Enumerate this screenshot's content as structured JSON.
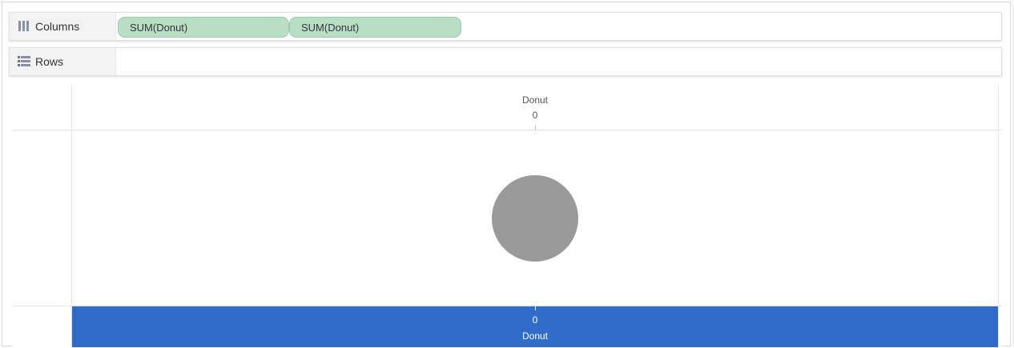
{
  "shelves": {
    "columns": {
      "label": "Columns",
      "icon": "columns-icon",
      "pills": [
        "SUM(Donut)",
        "SUM(Donut)"
      ]
    },
    "rows": {
      "label": "Rows",
      "icon": "rows-icon"
    }
  },
  "chart_data": {
    "type": "pie",
    "top_axis": {
      "title": "Donut",
      "tick_labels": [
        "0"
      ]
    },
    "bottom_axis": {
      "title": "Donut",
      "tick_labels": [
        "0"
      ]
    },
    "marks": [
      {
        "shape": "circle",
        "color": "#9a9a9a"
      }
    ]
  },
  "colors": {
    "pill": "#b8dfc6",
    "selected_axis": "#2f6bc8",
    "mark": "#9a9a9a"
  }
}
